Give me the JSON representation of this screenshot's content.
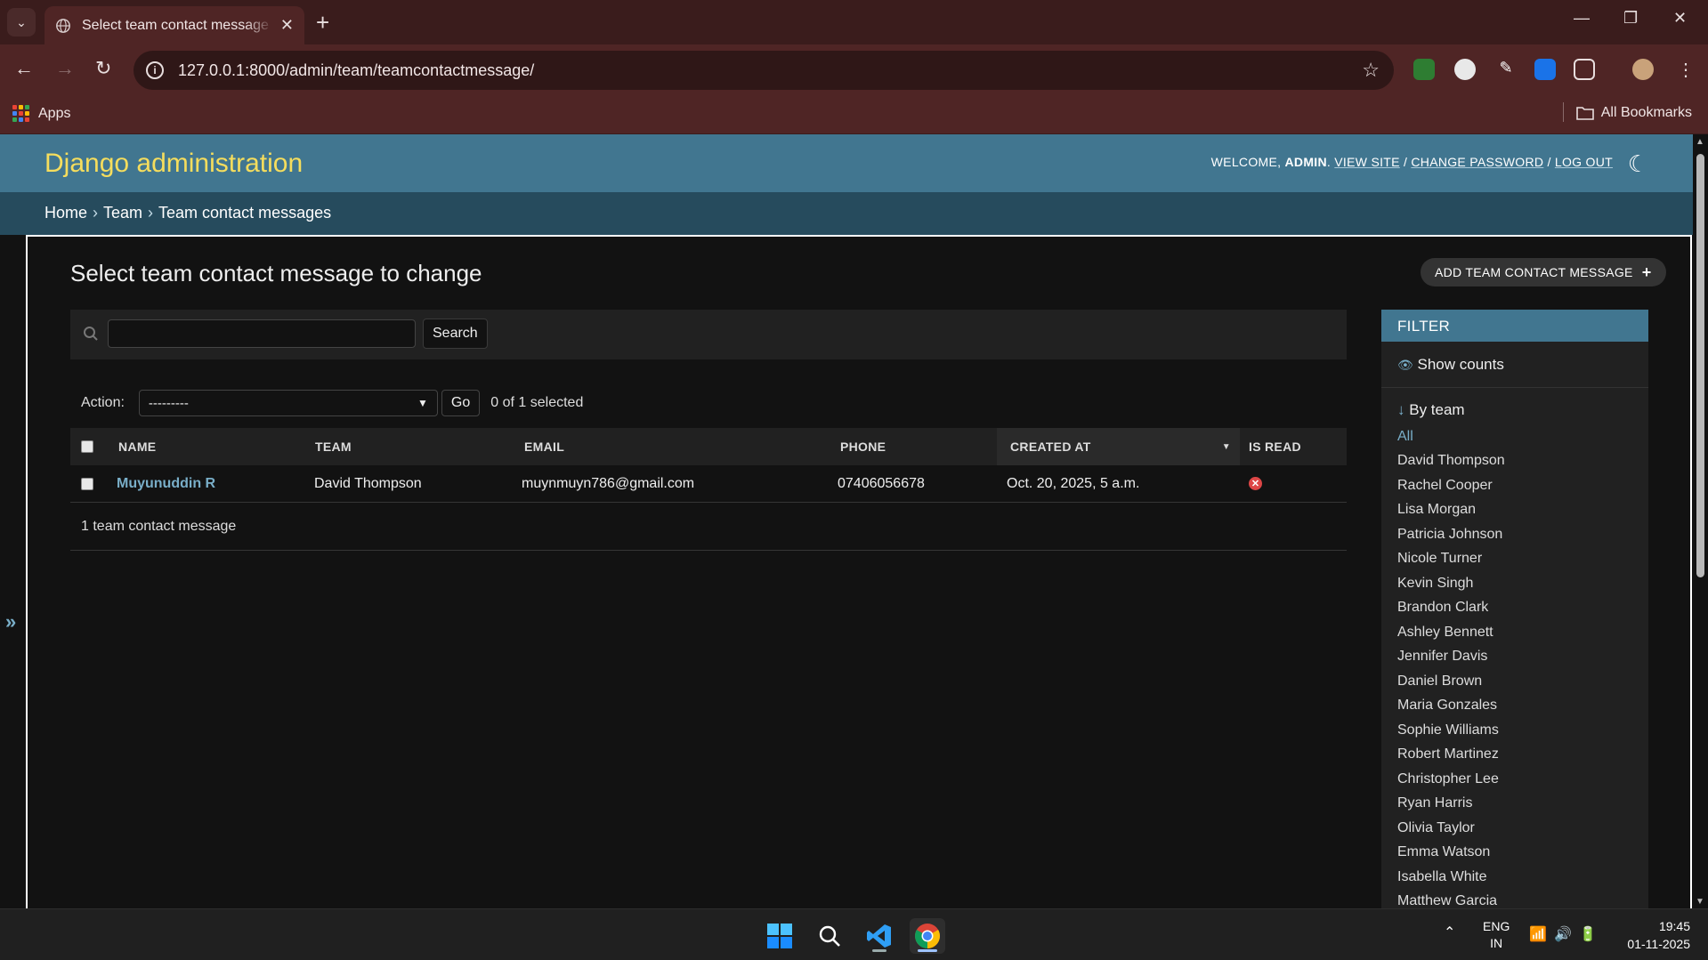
{
  "browser": {
    "tab_title": "Select team contact message to change | Django site admin",
    "url": "127.0.0.1:8000/admin/team/teamcontactmessage/",
    "bookmarks": {
      "apps_label": "Apps",
      "all_bookmarks_label": "All Bookmarks"
    }
  },
  "header": {
    "brand": "Django administration",
    "welcome": "WELCOME,",
    "user": "ADMIN",
    "view_site": "VIEW SITE",
    "change_password": "CHANGE PASSWORD",
    "log_out": "LOG OUT"
  },
  "breadcrumbs": [
    "Home",
    "Team",
    "Team contact messages"
  ],
  "content": {
    "title": "Select team contact message to change",
    "add_button": "ADD TEAM CONTACT MESSAGE",
    "search": {
      "value": "",
      "button": "Search"
    },
    "actions": {
      "label": "Action:",
      "selected": "---------",
      "go": "Go",
      "counter": "0 of 1 selected"
    },
    "table": {
      "columns": [
        "NAME",
        "TEAM",
        "EMAIL",
        "PHONE",
        "CREATED AT",
        "IS READ"
      ],
      "rows": [
        {
          "name": "Muyunuddin R",
          "team": "David Thompson",
          "email": "muynmuyn786@gmail.com",
          "phone": "07406056678",
          "created_at": "Oct. 20, 2025, 5 a.m.",
          "is_read": false
        }
      ],
      "paginator": "1 team contact message"
    }
  },
  "filter": {
    "title": "FILTER",
    "show_counts": "Show counts",
    "by_team_title": "By team",
    "options": [
      "All",
      "David Thompson",
      "Rachel Cooper",
      "Lisa Morgan",
      "Patricia Johnson",
      "Nicole Turner",
      "Kevin Singh",
      "Brandon Clark",
      "Ashley Bennett",
      "Jennifer Davis",
      "Daniel Brown",
      "Maria Gonzales",
      "Sophie Williams",
      "Robert Martinez",
      "Christopher Lee",
      "Ryan Harris",
      "Olivia Taylor",
      "Emma Watson",
      "Isabella White",
      "Matthew Garcia"
    ],
    "selected": "All"
  },
  "taskbar": {
    "lang": "ENG",
    "region": "IN",
    "time": "19:45",
    "date": "01-11-2025"
  },
  "colors": {
    "header_bg": "#417690",
    "breadcrumbs_bg": "#264b5d",
    "brand": "#f5dd5d",
    "link": "#79aec8",
    "error": "#dd4646"
  }
}
